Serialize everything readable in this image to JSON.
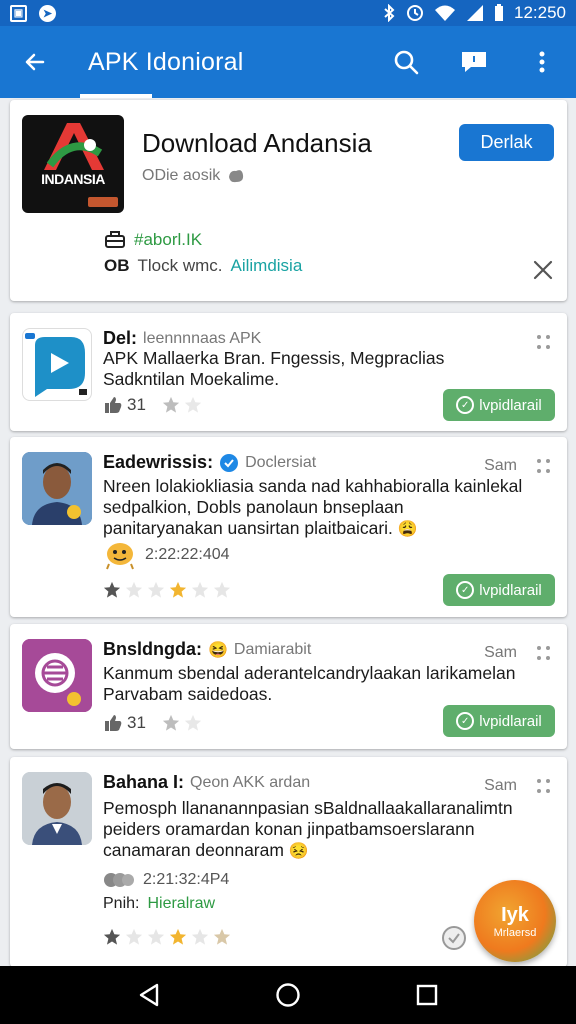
{
  "status_bar": {
    "time": "12:250",
    "left_icons": [
      "gallery-icon",
      "compass-icon"
    ],
    "right_icons": [
      "bluetooth-icon",
      "alarm-icon",
      "wifi-icon",
      "signal-icon",
      "battery-icon"
    ]
  },
  "app_bar": {
    "title": "APK Idonioral",
    "color": "#1976d2"
  },
  "hero": {
    "title": "Download Andansia",
    "subtitle": "ODie aosik",
    "logo_text": "INDANSIA",
    "button_label": "Derlak",
    "row1_value": "#aborl.IK",
    "row2_prefix": "OB",
    "row2_text": "Tlock wmc.",
    "row2_link": "Ailimdisia"
  },
  "reviews": [
    {
      "name": "Del:",
      "meta": "leennnnaas APK",
      "body": "APK Mallaerka Bran. Fngessis, Megpraclias Sadkntilan Moekalime.",
      "rating_count": "31",
      "button_label": "lvpidlarail"
    },
    {
      "name": "Eadewrissis:",
      "meta": "Doclersiat",
      "corner": "Sam",
      "body": "Nreen lolakiokliasia sanda nad kahhabioralla kainlekal sedpalkion, Dobls panolaun bnseplaan panitaryanakan uansirtan plaitbaicari.",
      "timestamp": "2:22:22:404",
      "button_label": "lvpidlarail"
    },
    {
      "name": "Bnsldngda:",
      "meta": "Damiarabit",
      "corner": "Sam",
      "body": "Kanmum sbendal aderantelcandrylaakan larikamelan Parvabam saidedoas.",
      "rating_count": "31",
      "button_label": "lvpidlarail"
    },
    {
      "name": "Bahana I:",
      "meta": "Qeon AKK ardan",
      "corner": "Sam",
      "body": "Pemosph llananannpasian sBaldnallaakallaranalimtn peiders oramardan konan jinpatbamsoerslarann canamaran deonnaram",
      "timestamp": "2:21:32:4P4",
      "footer_label": "Pnih:",
      "footer_value": "Hieralraw"
    }
  ],
  "fab": {
    "top": "Iyk",
    "bottom": "Mrlaersd"
  },
  "nav": {
    "buttons": [
      "back-icon",
      "home-icon",
      "recents-icon"
    ]
  }
}
